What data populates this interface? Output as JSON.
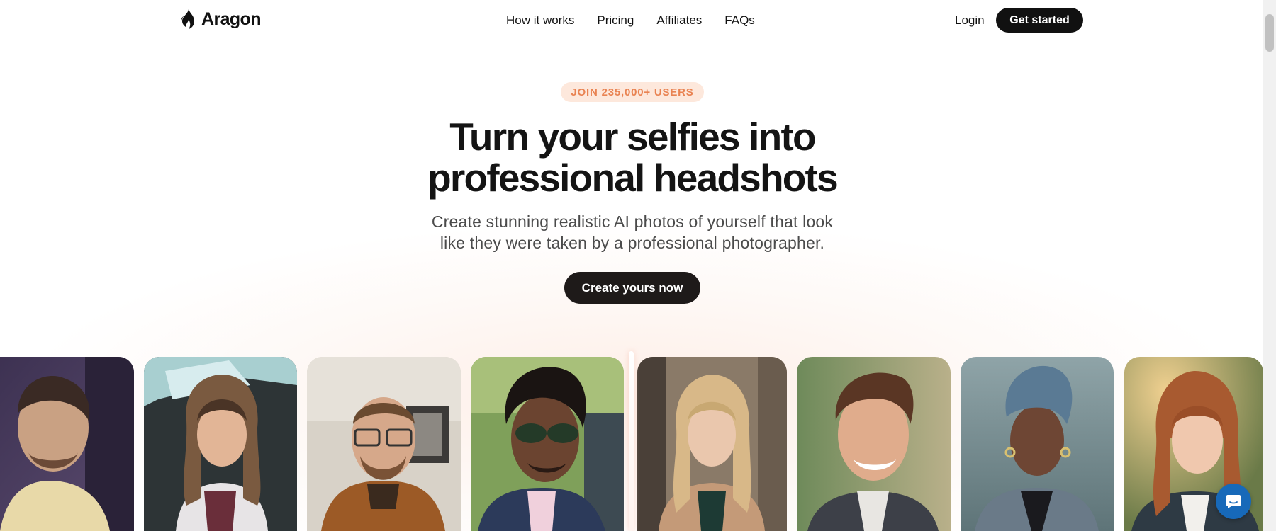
{
  "brand": {
    "name": "Aragon",
    "logo_icon": "flame-icon"
  },
  "nav": {
    "items": [
      {
        "label": "How it works"
      },
      {
        "label": "Pricing"
      },
      {
        "label": "Affiliates"
      },
      {
        "label": "FAQs"
      }
    ],
    "login_label": "Login",
    "get_started_label": "Get started"
  },
  "hero": {
    "badge": "JOIN 235,000+ USERS",
    "title_line1": "Turn your selfies into",
    "title_line2": "professional headshots",
    "subtitle_line1": "Create stunning realistic AI photos of yourself that look",
    "subtitle_line2": "like they were taken by a professional photographer.",
    "cta_label": "Create yours now"
  },
  "gallery": {
    "before_icon": "selfie-photo",
    "after_icon": "headshot-photo"
  },
  "colors": {
    "accent": "#e98352",
    "badge_bg": "#fde8dc",
    "button_dark": "#111111",
    "chat_blue": "#1769b9"
  },
  "chat": {
    "icon": "chat-bubble-icon"
  }
}
